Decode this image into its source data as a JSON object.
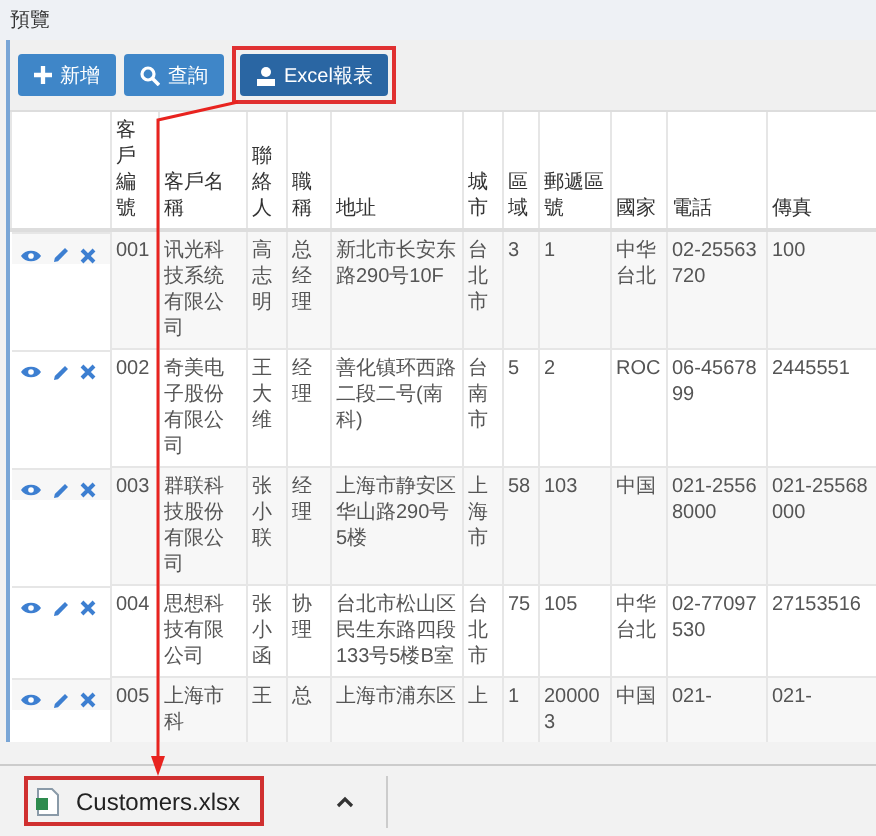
{
  "window": {
    "title": "預覽"
  },
  "toolbar": [
    {
      "label": "新增",
      "kind": "add",
      "pressed": false,
      "highlighted": false
    },
    {
      "label": "查詢",
      "kind": "search",
      "pressed": false,
      "highlighted": false
    },
    {
      "label": "Excel報表",
      "kind": "export",
      "pressed": true,
      "highlighted": true
    }
  ],
  "table": {
    "columns": [
      "客戶編號",
      "客戶名稱",
      "聯絡人",
      "職稱",
      "地址",
      "城市",
      "區域",
      "郵遞區號",
      "國家",
      "電話",
      "傳真"
    ],
    "rows": [
      {
        "cells": [
          "001",
          "讯光科技系统有限公司",
          "高志明",
          "总经理",
          "新北市长安东路290号10F",
          "台北市",
          "3",
          "1",
          "中华台北",
          "02-25563720",
          "100"
        ]
      },
      {
        "cells": [
          "002",
          "奇美电子股份有限公司",
          "王大维",
          "经理",
          "善化镇环西路二段二号(南科)",
          "台南市",
          "5",
          "2",
          "ROC",
          "06-4567899",
          "2445551"
        ]
      },
      {
        "cells": [
          "003",
          "群联科技股份有限公司",
          "张小联",
          "经理",
          "上海市静安区华山路290号5楼",
          "上海市",
          "58",
          "103",
          "中国",
          "021-25568000",
          "021-25568000"
        ]
      },
      {
        "cells": [
          "004",
          "思想科技有限公司",
          "张小函",
          "协理",
          "台北市松山区民生东路四段133号5楼B室",
          "台北市",
          "75",
          "105",
          "中华台北",
          "02-77097530",
          "27153516"
        ]
      },
      {
        "cells": [
          "005",
          "上海市科",
          "王",
          "总",
          "上海市浦东区",
          "上",
          "1",
          "200003",
          "中国",
          "021-",
          "021-"
        ]
      }
    ]
  },
  "download_bar": {
    "file": "Customers.xlsx",
    "highlighted": true
  }
}
